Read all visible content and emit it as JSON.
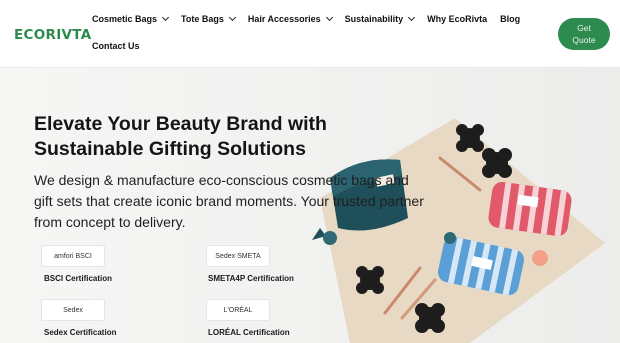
{
  "header": {
    "logo": "ECORIVTA",
    "nav": [
      {
        "label": "Cosmetic Bags",
        "dropdown": true
      },
      {
        "label": "Tote Bags",
        "dropdown": true
      },
      {
        "label": "Hair Accessories",
        "dropdown": true
      },
      {
        "label": "Sustainability",
        "dropdown": true
      },
      {
        "label": "Why EcoRivta",
        "dropdown": false
      },
      {
        "label": "Blog",
        "dropdown": false
      }
    ],
    "nav_row2": [
      {
        "label": "Contact Us"
      }
    ],
    "cta_line1": "Get",
    "cta_line2": "Quote"
  },
  "hero": {
    "headline": "Elevate Your Beauty Brand with Sustainable Gifting Solutions",
    "lead": "We design & manufacture eco-conscious cosmetic bags and gift sets that create iconic brand moments. Your trusted partner from concept to delivery.",
    "certifications": [
      {
        "logo_text": "amfori BSCI",
        "label": "BSCI Certification"
      },
      {
        "logo_text": "Sedex SMETA",
        "label": "SMETA4P Certification"
      },
      {
        "logo_text": "Sedex",
        "label": "Sedex Certification"
      },
      {
        "logo_text": "L'ORÉAL",
        "label": "LORÉAL Certification"
      }
    ]
  },
  "colors": {
    "brand_green": "#2e8b4f",
    "text": "#151515"
  }
}
